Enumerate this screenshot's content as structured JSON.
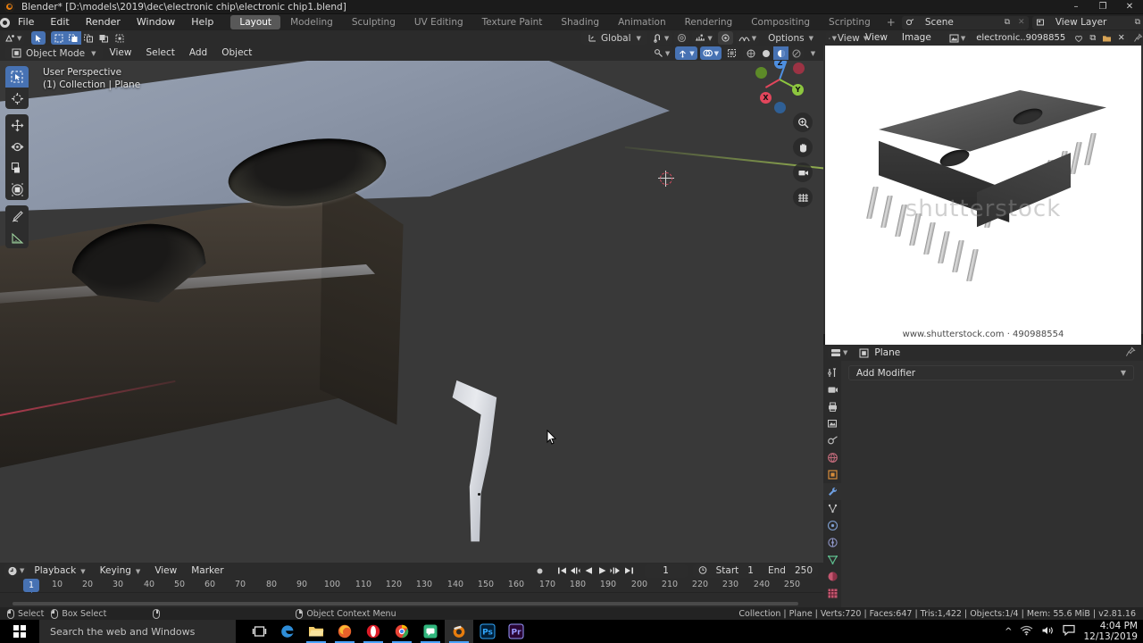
{
  "window": {
    "title": "Blender* [D:\\models\\2019\\dec\\electronic chip\\electronic chip1.blend]",
    "minimize": "–",
    "maximize": "❐",
    "close": "✕"
  },
  "topbar": {
    "menus": [
      "File",
      "Edit",
      "Render",
      "Window",
      "Help"
    ],
    "workspaces": [
      {
        "label": "Layout",
        "active": true
      },
      {
        "label": "Modeling",
        "active": false
      },
      {
        "label": "Sculpting",
        "active": false
      },
      {
        "label": "UV Editing",
        "active": false
      },
      {
        "label": "Texture Paint",
        "active": false
      },
      {
        "label": "Shading",
        "active": false
      },
      {
        "label": "Animation",
        "active": false
      },
      {
        "label": "Rendering",
        "active": false
      },
      {
        "label": "Compositing",
        "active": false
      },
      {
        "label": "Scripting",
        "active": false
      }
    ],
    "add_workspace": "+",
    "scene_name": "Scene",
    "view_layer_name": "View Layer",
    "new_btn": "⧉",
    "unlink_btn": "✕"
  },
  "viewport": {
    "mode": "Object Mode",
    "menus": [
      "View",
      "Select",
      "Add",
      "Object"
    ],
    "transform_orientation": "Global",
    "options_label": "Options",
    "overlay_text_line1": "User Perspective",
    "overlay_text_line2": "(1) Collection | Plane",
    "tools": [
      "tweak-select-tool",
      "cursor-tool",
      "move-tool",
      "rotate-tool",
      "scale-tool",
      "transform-tool",
      "annotate-tool",
      "measure-tool"
    ],
    "gizmo_axes": [
      {
        "label": "Z",
        "color": "#4e8fe0"
      },
      {
        "label": "Y",
        "color": "#8dc63f"
      },
      {
        "label": "X",
        "color": "#e2465c"
      }
    ],
    "nav_buttons": [
      "zoom-icon",
      "pan-hand-icon",
      "camera-icon",
      "grid-ortho-icon"
    ]
  },
  "image_editor": {
    "editor_type": "image-editor-icon",
    "view_mode_menu": "View",
    "menus": [
      "View",
      "Image"
    ],
    "image_name": "electronic..9098855",
    "fake_user_btn": "♡",
    "new_btn": "⧉",
    "open_btn": "📁",
    "unlink_btn": "✕",
    "pin_btn": "📌",
    "display_channels": "display-channels-icon",
    "watermark": "shutterstock",
    "caption": "www.shutterstock.com · 490988554"
  },
  "properties": {
    "breadcrumb_object": "Plane",
    "pin_icon": "pin-icon",
    "add_modifier_label": "Add Modifier",
    "tabs": [
      "tool-icon",
      "render-icon",
      "output-icon",
      "view-layer-icon",
      "scene-icon",
      "world-icon",
      "object-icon",
      "modifier-icon",
      "particles-icon",
      "physics-icon",
      "constraints-icon",
      "data-icon",
      "material-icon",
      "texture-icon"
    ],
    "active_tab_index": 7
  },
  "timeline": {
    "editor_icon": "timeline-icon",
    "menus": [
      "Playback",
      "Keying",
      "View",
      "Marker"
    ],
    "playback_buttons": [
      "record-icon",
      "jump-start-icon",
      "prev-keyframe-icon",
      "play-reverse-icon",
      "play-icon",
      "next-keyframe-icon",
      "jump-end-icon"
    ],
    "current_frame": "1",
    "start_label": "Start",
    "start_value": "1",
    "end_label": "End",
    "end_value": "250",
    "ticks": [
      10,
      20,
      30,
      40,
      50,
      60,
      70,
      80,
      90,
      100,
      110,
      120,
      130,
      140,
      150,
      160,
      170,
      180,
      190,
      200,
      210,
      220,
      230,
      240,
      250
    ],
    "playhead_label": "1"
  },
  "statusbar": {
    "keymap": [
      {
        "icon": "mouse-left-icon",
        "label": "Select"
      },
      {
        "icon": "mouse-left-drag-icon",
        "label": "Box Select"
      },
      {
        "icon": "mouse-middle-icon",
        "label": ""
      },
      {
        "icon": "mouse-right-icon",
        "label": "Object Context Menu"
      }
    ],
    "scene_stats": "Collection | Plane | Verts:720 | Faces:647 | Tris:1,422 | Objects:1/4 | Mem: 55.6 MiB | v2.81.16"
  },
  "taskbar": {
    "search_placeholder": "Search the web and Windows",
    "apps": [
      {
        "name": "task-view-icon",
        "open": false
      },
      {
        "name": "edge-icon",
        "open": false
      },
      {
        "name": "file-explorer-icon",
        "open": true
      },
      {
        "name": "firefox-icon",
        "open": true
      },
      {
        "name": "opera-icon",
        "open": true
      },
      {
        "name": "chrome-icon",
        "open": true
      },
      {
        "name": "messaging-icon",
        "open": true
      },
      {
        "name": "blender-icon",
        "open": true
      },
      {
        "name": "photoshop-icon",
        "open": false
      },
      {
        "name": "premiere-icon",
        "open": false
      }
    ],
    "tray_icons": [
      "show-hidden-icon",
      "wifi-icon",
      "volume-icon",
      "action-center-icon"
    ],
    "time": "4:04 PM",
    "date": "12/13/2019"
  }
}
